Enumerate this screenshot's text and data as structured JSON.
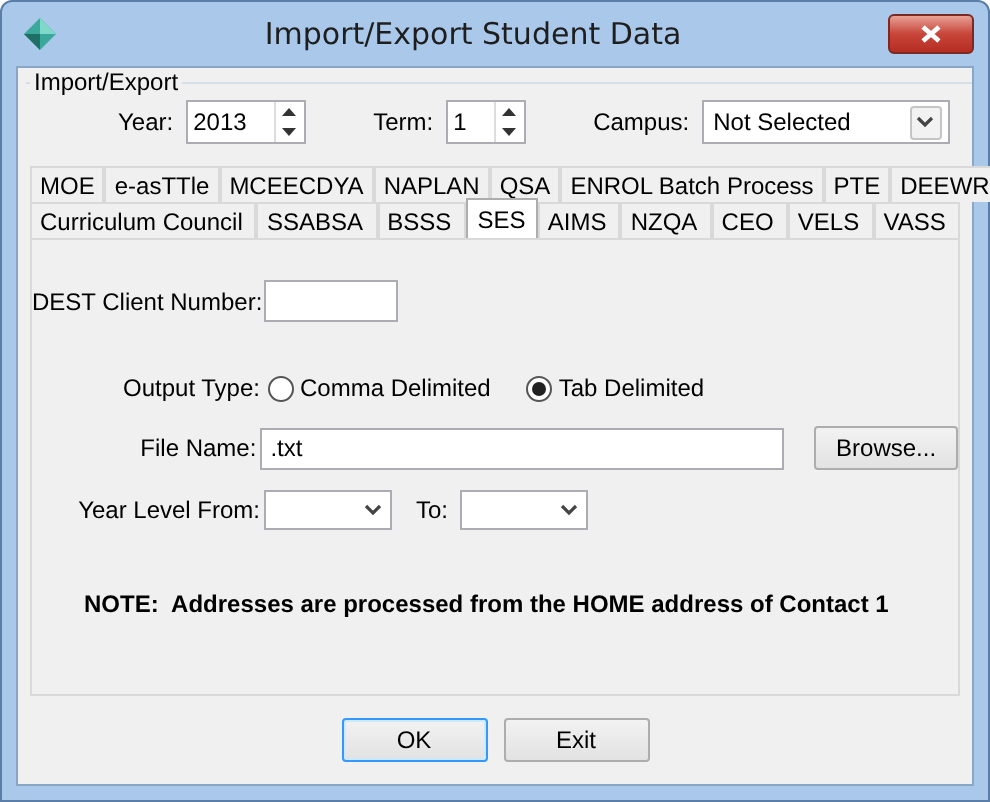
{
  "window": {
    "title": "Import/Export Student Data"
  },
  "group": {
    "title": "Import/Export",
    "fields": [
      {
        "kind": "spin",
        "label": "Year:",
        "value": "2013"
      },
      {
        "kind": "spin",
        "label": "Term:",
        "value": "1"
      },
      {
        "kind": "combo",
        "label": "Campus:",
        "value": "Not Selected"
      }
    ]
  },
  "tab_rows": [
    [
      {
        "label": "MOE",
        "selected": false
      },
      {
        "label": "e-asTTle",
        "selected": false
      },
      {
        "label": "MCEECDYA",
        "selected": false
      },
      {
        "label": "NAPLAN",
        "selected": false
      },
      {
        "label": "QSA",
        "selected": false
      },
      {
        "label": "ENROL Batch Process",
        "selected": false
      },
      {
        "label": "PTE",
        "selected": false
      },
      {
        "label": "DEEWR",
        "selected": false
      }
    ],
    [
      {
        "label": "Curriculum Council",
        "selected": false
      },
      {
        "label": "SSABSA",
        "selected": false
      },
      {
        "label": "BSSS",
        "selected": false
      },
      {
        "label": "SES",
        "selected": true
      },
      {
        "label": "AIMS",
        "selected": false
      },
      {
        "label": "NZQA",
        "selected": false
      },
      {
        "label": "CEO",
        "selected": false
      },
      {
        "label": "VELS",
        "selected": false
      },
      {
        "label": "VASS",
        "selected": false
      }
    ]
  ],
  "panel": {
    "dest_client_number": {
      "label": "DEST Client Number:"
    },
    "output_type": {
      "label": "Output Type:",
      "options": [
        {
          "label": "Comma Delimited",
          "selected": false
        },
        {
          "label": "Tab Delimited",
          "selected": true
        }
      ]
    },
    "file_name": {
      "label": "File Name:",
      "value": ".txt",
      "button": "Browse..."
    },
    "year_level": {
      "from_label": "Year Level From:",
      "to_label": "To:"
    },
    "note": "NOTE:  Addresses are processed from the HOME address of Contact 1"
  },
  "buttons": [
    {
      "label": "OK",
      "focused": true
    },
    {
      "label": "Exit",
      "focused": false
    }
  ]
}
